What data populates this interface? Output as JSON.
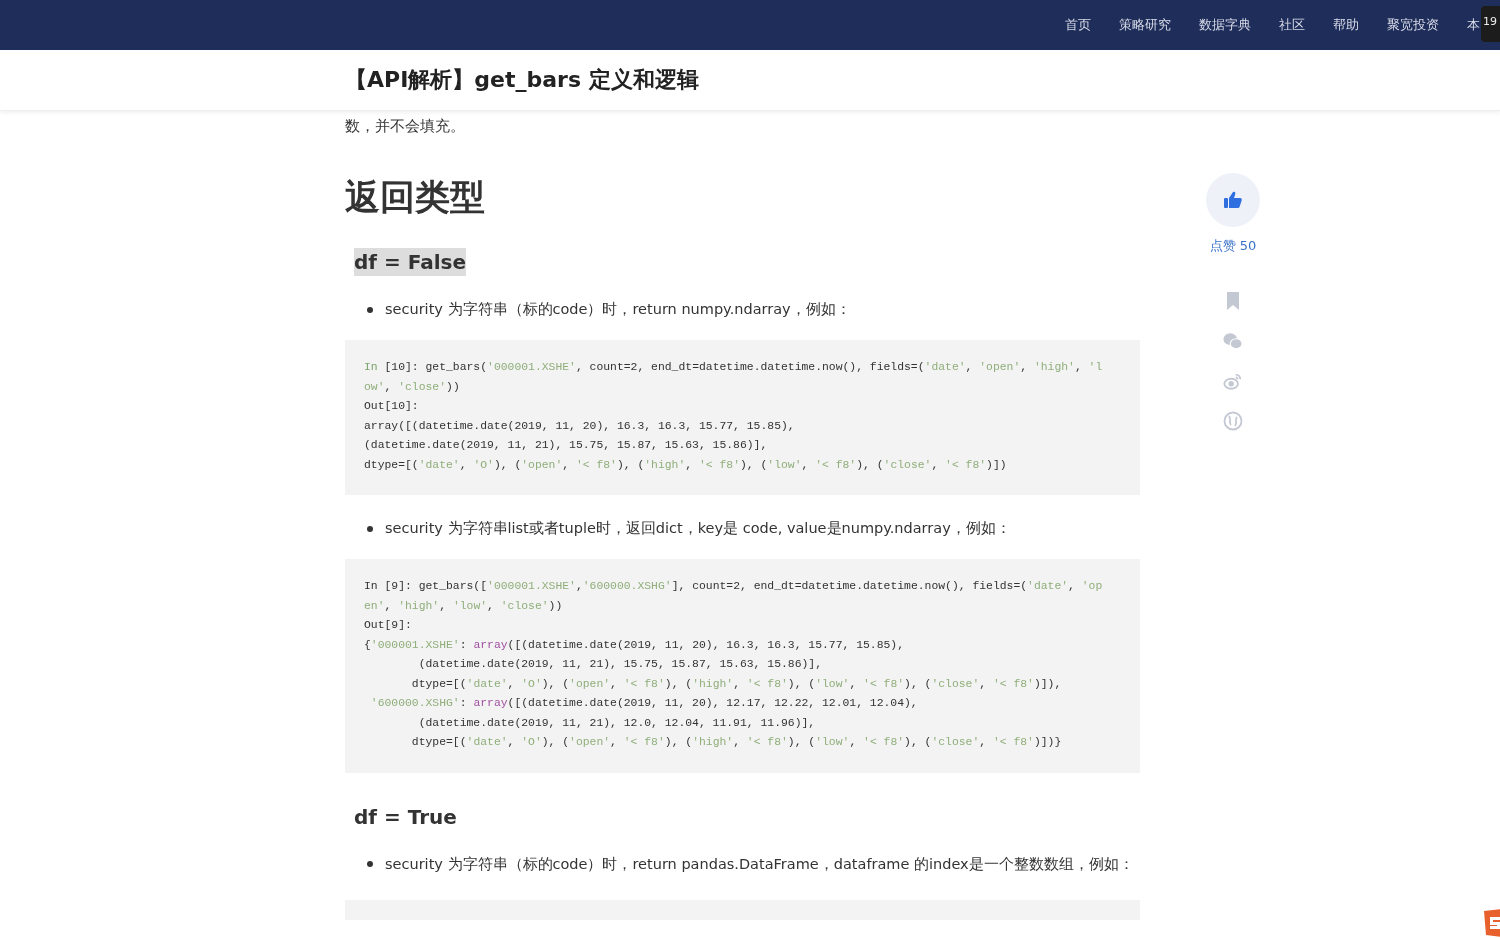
{
  "nav": {
    "items": [
      {
        "label": "首页"
      },
      {
        "label": "策略研究"
      },
      {
        "label": "数据字典"
      },
      {
        "label": "社区"
      },
      {
        "label": "帮助"
      },
      {
        "label": "聚宽投资"
      },
      {
        "label": "本"
      }
    ],
    "tooltip": "19"
  },
  "article": {
    "title": "【API解析】get_bars 定义和逻辑",
    "content": [
      {
        "kind": "p",
        "text": "数，并不会填充。"
      },
      {
        "kind": "h2",
        "text": "返回类型"
      },
      {
        "kind": "h3",
        "text": "df = False",
        "highlighted": true
      },
      {
        "kind": "bullet",
        "text": "security 为字符串（标的code）时，return numpy.ndarray，例如："
      },
      {
        "kind": "code",
        "lines": [
          [
            {
              "text": "In",
              "kind": "keyword"
            },
            {
              "text": " [10]: get_bars(",
              "kind": "plain"
            },
            {
              "text": "'000001.XSHE'",
              "kind": "string"
            },
            {
              "text": ", count=2, end_dt=datetime.datetime.now(), fields=(",
              "kind": "plain"
            },
            {
              "text": "'date'",
              "kind": "string"
            },
            {
              "text": ", ",
              "kind": "plain"
            },
            {
              "text": "'open'",
              "kind": "string"
            },
            {
              "text": ", ",
              "kind": "plain"
            },
            {
              "text": "'high'",
              "kind": "string"
            },
            {
              "text": ", ",
              "kind": "plain"
            },
            {
              "text": "'l",
              "kind": "string"
            }
          ],
          [
            {
              "text": "ow'",
              "kind": "string"
            },
            {
              "text": ", ",
              "kind": "plain"
            },
            {
              "text": "'close'",
              "kind": "string"
            },
            {
              "text": "))",
              "kind": "plain"
            }
          ],
          [
            {
              "text": "Out[10]:",
              "kind": "plain"
            }
          ],
          [
            {
              "text": "array([(datetime.date(2019, 11, 20), 16.3, 16.3, 15.77, 15.85),",
              "kind": "plain"
            }
          ],
          [
            {
              "text": "(datetime.date(2019, 11, 21), 15.75, 15.87, 15.63, 15.86)],",
              "kind": "plain"
            }
          ],
          [
            {
              "text": "dtype=[(",
              "kind": "plain"
            },
            {
              "text": "'date'",
              "kind": "string"
            },
            {
              "text": ", ",
              "kind": "plain"
            },
            {
              "text": "'O'",
              "kind": "string"
            },
            {
              "text": "), (",
              "kind": "plain"
            },
            {
              "text": "'open'",
              "kind": "string"
            },
            {
              "text": ", ",
              "kind": "plain"
            },
            {
              "text": "'< f8'",
              "kind": "string"
            },
            {
              "text": "), (",
              "kind": "plain"
            },
            {
              "text": "'high'",
              "kind": "string"
            },
            {
              "text": ", ",
              "kind": "plain"
            },
            {
              "text": "'< f8'",
              "kind": "string"
            },
            {
              "text": "), (",
              "kind": "plain"
            },
            {
              "text": "'low'",
              "kind": "string"
            },
            {
              "text": ", ",
              "kind": "plain"
            },
            {
              "text": "'< f8'",
              "kind": "string"
            },
            {
              "text": "), (",
              "kind": "plain"
            },
            {
              "text": "'close'",
              "kind": "string"
            },
            {
              "text": ", ",
              "kind": "plain"
            },
            {
              "text": "'< f8'",
              "kind": "string"
            },
            {
              "text": ")])",
              "kind": "plain"
            }
          ]
        ]
      },
      {
        "kind": "bullet",
        "text": "security 为字符串list或者tuple时，返回dict，key是 code, value是numpy.ndarray，例如："
      },
      {
        "kind": "code",
        "lines": [
          [
            {
              "text": "In [9]: get_bars([",
              "kind": "plain"
            },
            {
              "text": "'000001.XSHE'",
              "kind": "string"
            },
            {
              "text": ",",
              "kind": "plain"
            },
            {
              "text": "'600000.XSHG'",
              "kind": "string"
            },
            {
              "text": "], count=2, end_dt=datetime.datetime.now(), fields=(",
              "kind": "plain"
            },
            {
              "text": "'date'",
              "kind": "string"
            },
            {
              "text": ", ",
              "kind": "plain"
            },
            {
              "text": "'op",
              "kind": "string"
            }
          ],
          [
            {
              "text": "en'",
              "kind": "string"
            },
            {
              "text": ", ",
              "kind": "plain"
            },
            {
              "text": "'high'",
              "kind": "string"
            },
            {
              "text": ", ",
              "kind": "plain"
            },
            {
              "text": "'low'",
              "kind": "string"
            },
            {
              "text": ", ",
              "kind": "plain"
            },
            {
              "text": "'close'",
              "kind": "string"
            },
            {
              "text": "))",
              "kind": "plain"
            }
          ],
          [
            {
              "text": "Out[9]:",
              "kind": "plain"
            }
          ],
          [
            {
              "text": "{",
              "kind": "plain"
            },
            {
              "text": "'000001.XSHE'",
              "kind": "string"
            },
            {
              "text": ": ",
              "kind": "plain"
            },
            {
              "text": "array",
              "kind": "builtin"
            },
            {
              "text": "([(datetime.date(2019, 11, 20), 16.3, 16.3, 15.77, 15.85),",
              "kind": "plain"
            }
          ],
          [
            {
              "text": "        (datetime.date(2019, 11, 21), 15.75, 15.87, 15.63, 15.86)],",
              "kind": "plain"
            }
          ],
          [
            {
              "text": "       dtype=[(",
              "kind": "plain"
            },
            {
              "text": "'date'",
              "kind": "string"
            },
            {
              "text": ", ",
              "kind": "plain"
            },
            {
              "text": "'O'",
              "kind": "string"
            },
            {
              "text": "), (",
              "kind": "plain"
            },
            {
              "text": "'open'",
              "kind": "string"
            },
            {
              "text": ", ",
              "kind": "plain"
            },
            {
              "text": "'< f8'",
              "kind": "string"
            },
            {
              "text": "), (",
              "kind": "plain"
            },
            {
              "text": "'high'",
              "kind": "string"
            },
            {
              "text": ", ",
              "kind": "plain"
            },
            {
              "text": "'< f8'",
              "kind": "string"
            },
            {
              "text": "), (",
              "kind": "plain"
            },
            {
              "text": "'low'",
              "kind": "string"
            },
            {
              "text": ", ",
              "kind": "plain"
            },
            {
              "text": "'< f8'",
              "kind": "string"
            },
            {
              "text": "), (",
              "kind": "plain"
            },
            {
              "text": "'close'",
              "kind": "string"
            },
            {
              "text": ", ",
              "kind": "plain"
            },
            {
              "text": "'< f8'",
              "kind": "string"
            },
            {
              "text": ")]),",
              "kind": "plain"
            }
          ],
          [
            {
              "text": " '600000.XSHG'",
              "kind": "string"
            },
            {
              "text": ": ",
              "kind": "plain"
            },
            {
              "text": "array",
              "kind": "builtin"
            },
            {
              "text": "([(datetime.date(2019, 11, 20), 12.17, 12.22, 12.01, 12.04),",
              "kind": "plain"
            }
          ],
          [
            {
              "text": "        (datetime.date(2019, 11, 21), 12.0, 12.04, 11.91, 11.96)],",
              "kind": "plain"
            }
          ],
          [
            {
              "text": "       dtype=[(",
              "kind": "plain"
            },
            {
              "text": "'date'",
              "kind": "string"
            },
            {
              "text": ", ",
              "kind": "plain"
            },
            {
              "text": "'O'",
              "kind": "string"
            },
            {
              "text": "), (",
              "kind": "plain"
            },
            {
              "text": "'open'",
              "kind": "string"
            },
            {
              "text": ", ",
              "kind": "plain"
            },
            {
              "text": "'< f8'",
              "kind": "string"
            },
            {
              "text": "), (",
              "kind": "plain"
            },
            {
              "text": "'high'",
              "kind": "string"
            },
            {
              "text": ", ",
              "kind": "plain"
            },
            {
              "text": "'< f8'",
              "kind": "string"
            },
            {
              "text": "), (",
              "kind": "plain"
            },
            {
              "text": "'low'",
              "kind": "string"
            },
            {
              "text": ", ",
              "kind": "plain"
            },
            {
              "text": "'< f8'",
              "kind": "string"
            },
            {
              "text": "), (",
              "kind": "plain"
            },
            {
              "text": "'close'",
              "kind": "string"
            },
            {
              "text": ", ",
              "kind": "plain"
            },
            {
              "text": "'< f8'",
              "kind": "string"
            },
            {
              "text": ")])}",
              "kind": "plain"
            }
          ]
        ]
      },
      {
        "kind": "h3",
        "text": "df  = True",
        "highlighted": false
      },
      {
        "kind": "bullet",
        "text": "security 为字符串（标的code）时，return pandas.DataFrame，dataframe 的index是一个整数数组，例如："
      },
      {
        "kind": "code"
      }
    ]
  },
  "sidebar": {
    "like_label": "点赞 50"
  }
}
